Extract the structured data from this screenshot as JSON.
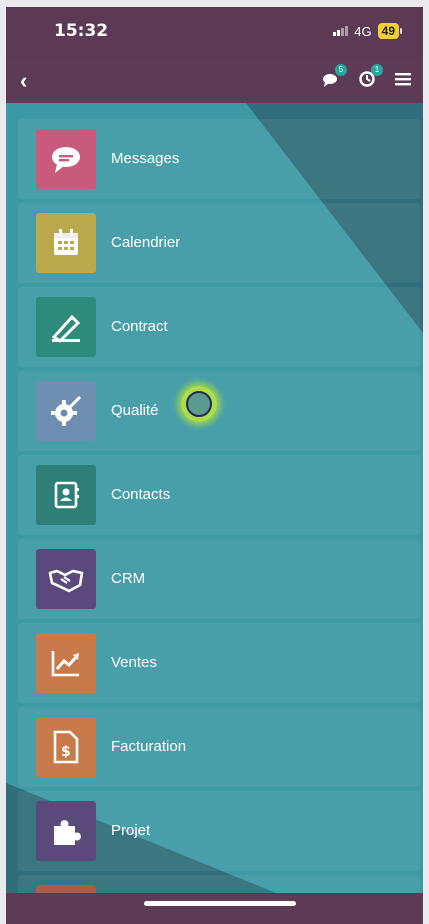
{
  "status_bar": {
    "time": "15:32",
    "network": "4G",
    "battery": "49"
  },
  "nav": {
    "chat_badge": "5",
    "activity_badge": "1"
  },
  "apps": [
    {
      "label": "Messages",
      "icon": "chat-bubble-icon",
      "color": "#c85a7c"
    },
    {
      "label": "Calendrier",
      "icon": "calendar-icon",
      "color": "#b9a84c"
    },
    {
      "label": "Contract",
      "icon": "pen-icon",
      "color": "#2e8a7a"
    },
    {
      "label": "Qualité",
      "icon": "quality-gear-icon",
      "color": "#6f8fb0"
    },
    {
      "label": "Contacts",
      "icon": "contact-book-icon",
      "color": "#2e7f78"
    },
    {
      "label": "CRM",
      "icon": "handshake-icon",
      "color": "#5a4a7c"
    },
    {
      "label": "Ventes",
      "icon": "chart-up-icon",
      "color": "#c97a4a"
    },
    {
      "label": "Facturation",
      "icon": "invoice-icon",
      "color": "#c97a4a"
    },
    {
      "label": "Projet",
      "icon": "puzzle-icon",
      "color": "#5a4a7c"
    },
    {
      "label": "",
      "icon": "partial-app-icon",
      "color": "#b05a4a"
    }
  ]
}
